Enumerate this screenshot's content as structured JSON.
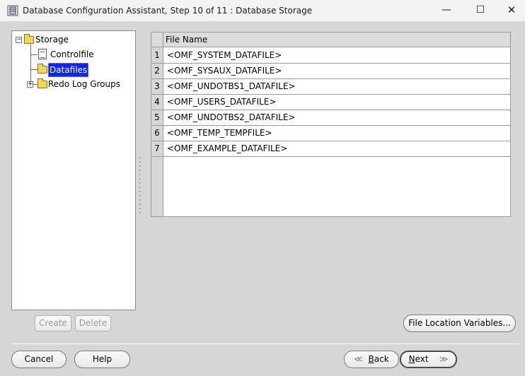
{
  "window": {
    "title": "Database Configuration Assistant, Step 10 of 11 : Database Storage",
    "minimize_glyph": "—",
    "maximize_glyph": "☐",
    "close_glyph": "✕",
    "icon": "database-app-icon"
  },
  "tree": {
    "root": {
      "label": "Storage",
      "toggle": "−"
    },
    "items": [
      {
        "label": "Controlfile",
        "icon": "document-icon"
      },
      {
        "label": "Datafiles",
        "icon": "folder-icon",
        "selected": true
      },
      {
        "label": "Redo Log Groups",
        "icon": "folder-icon",
        "toggle": "+"
      }
    ]
  },
  "grid": {
    "column_header": "File Name",
    "rows": [
      {
        "num": "1",
        "file": "<OMF_SYSTEM_DATAFILE>"
      },
      {
        "num": "2",
        "file": "<OMF_SYSAUX_DATAFILE>"
      },
      {
        "num": "3",
        "file": "<OMF_UNDOTBS1_DATAFILE>"
      },
      {
        "num": "4",
        "file": "<OMF_USERS_DATAFILE>"
      },
      {
        "num": "5",
        "file": "<OMF_UNDOTBS2_DATAFILE>"
      },
      {
        "num": "6",
        "file": "<OMF_TEMP_TEMPFILE>"
      },
      {
        "num": "7",
        "file": "<OMF_EXAMPLE_DATAFILE>"
      }
    ]
  },
  "buttons": {
    "create": "Create",
    "delete": "Delete",
    "file_location_variables": "File Location Variables...",
    "cancel": "Cancel",
    "help": "Help",
    "back_first": "B",
    "back_rest": "ack",
    "next_first": "N",
    "next_rest": "ext",
    "back_chevron": "≪",
    "next_chevron": "≫"
  }
}
